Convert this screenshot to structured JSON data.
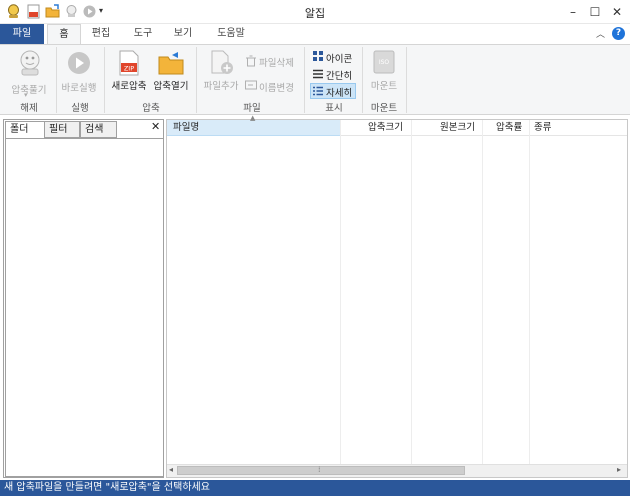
{
  "app": {
    "title": "알집"
  },
  "window_buttons": {
    "minimize": "–",
    "maximize": "☐",
    "close": "✕"
  },
  "ribbon_tabs": [
    "파일",
    "홈",
    "편집",
    "도구",
    "보기",
    "도움말"
  ],
  "ribbon": {
    "extract_label": "압축풀기",
    "run_label": "바로실행",
    "new_archive_label": "새로압축",
    "open_archive_label": "압축열기",
    "zip_badge": "ZIP",
    "add_file_label": "파일추가",
    "delete_file_label": "파일삭제",
    "rename_label": "이름변경",
    "view_icon_label": "아이콘",
    "view_simple_label": "간단히",
    "view_detail_label": "자세히",
    "mount_label": "마운트",
    "iso_badge": "ISO",
    "groups": [
      "해제",
      "실행",
      "압축",
      "파일",
      "표시",
      "마운트"
    ]
  },
  "left_panel": {
    "tabs": [
      "폴더",
      "필터",
      "검색"
    ],
    "close": "✕"
  },
  "file_list": {
    "columns": [
      "파일명",
      "압축크기",
      "원본크기",
      "압축률",
      "종류"
    ],
    "rows": []
  },
  "status": {
    "text": "새 압축파일을 만들려면 \"새로압축\"을 선택하세요"
  },
  "colors": {
    "accent": "#2b579a",
    "selected_header": "#d9ebf9",
    "view_selected": "#cce4f7"
  }
}
